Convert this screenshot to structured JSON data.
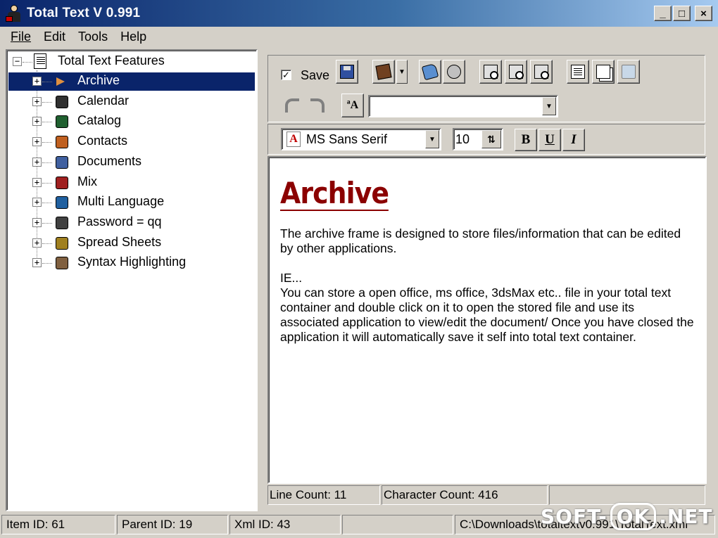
{
  "window": {
    "title": "Total Text V 0.991",
    "controls": [
      "_",
      "□",
      "×"
    ]
  },
  "menu": [
    "File",
    "Edit",
    "Tools",
    "Help"
  ],
  "tree": {
    "root": "Total Text Features",
    "items": [
      {
        "label": "Archive",
        "icon": "archive-arrow-icon",
        "selected": true
      },
      {
        "label": "Calendar",
        "icon": "calendar-icon"
      },
      {
        "label": "Catalog",
        "icon": "catalog-book-icon"
      },
      {
        "label": "Contacts",
        "icon": "contacts-icon"
      },
      {
        "label": "Documents",
        "icon": "document-icon"
      },
      {
        "label": "Mix",
        "icon": "mix-icon"
      },
      {
        "label": "Multi Language",
        "icon": "globe-icon"
      },
      {
        "label": "Password = qq",
        "icon": "password-key-icon"
      },
      {
        "label": "Spread Sheets",
        "icon": "calculator-icon"
      },
      {
        "label": "Syntax Highlighting",
        "icon": "pen-paper-icon"
      }
    ]
  },
  "toolbar": {
    "save_label": "Save",
    "save_checked": true,
    "search_value": ""
  },
  "format": {
    "font": "MS Sans Serif",
    "size": "10",
    "bold": "B",
    "underline": "U",
    "italic": "I"
  },
  "editor": {
    "title": "Archive",
    "para1": "The archive frame is designed to store files/information that can be edited by other applications.",
    "para2a": "IE...",
    "para2b": "You can store a open office, ms office, 3dsMax etc.. file in your total text container and double click on it to open the stored file and use its associated application to view/edit the document/ Once you have closed the application it will automatically save it self into total text container."
  },
  "editor_status": {
    "line_count": "Line Count: 11",
    "char_count": "Character Count: 416"
  },
  "status": {
    "item_id": "Item ID: 61",
    "parent_id": "Parent ID: 19",
    "xml_id": "Xml ID: 43",
    "path": "C:\\Downloads\\totaltextv0.991\\TotalText.xml"
  },
  "watermark": {
    "left": "SOFT-",
    "ok": "OK",
    "right": ".NET"
  }
}
